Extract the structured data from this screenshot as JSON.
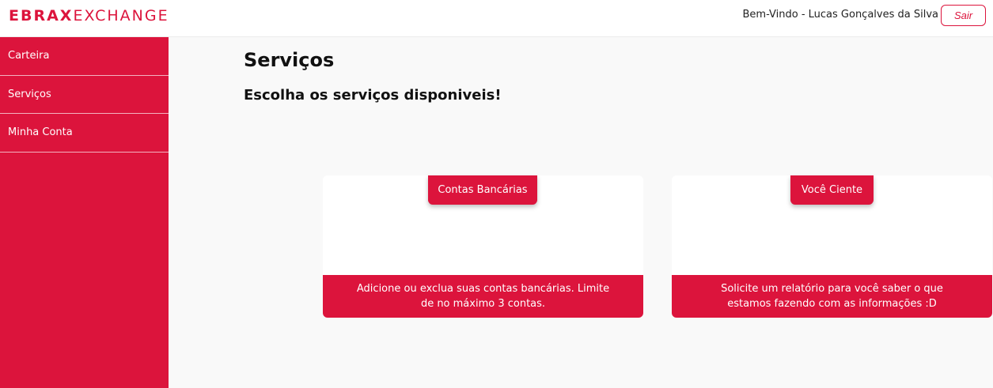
{
  "header": {
    "logo_bold": "EBRAX",
    "logo_light": "EXCHANGE",
    "welcome_text": "Bem-Vindo - Lucas Gonçalves da Silva",
    "logout_label": "Sair"
  },
  "sidebar": {
    "items": [
      {
        "label": "Carteira"
      },
      {
        "label": "Serviços"
      },
      {
        "label": "Minha Conta"
      }
    ]
  },
  "main": {
    "title": "Serviços",
    "subtitle": "Escolha os serviços disponiveis!",
    "cards": [
      {
        "title": "Contas Bancárias",
        "description": "Adicione ou exclua suas contas bancárias. Limite de no máximo 3 contas."
      },
      {
        "title": "Você Ciente",
        "description": "Solicite um relatório para você saber o que estamos fazendo com as informações :D"
      }
    ]
  },
  "colors": {
    "brand": "#dc143c",
    "background": "#f9f9f9",
    "card": "#ffffff"
  }
}
